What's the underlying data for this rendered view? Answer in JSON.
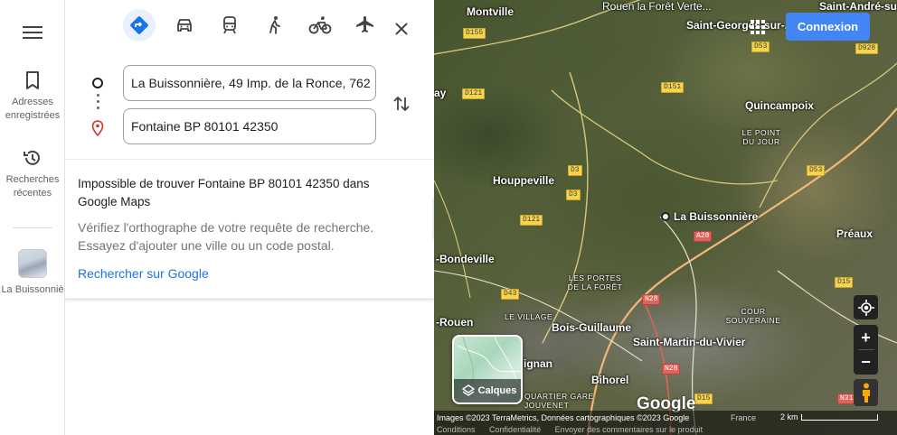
{
  "rail": {
    "saved_label": "Adresses enregistrées",
    "recent_label": "Recherches récentes",
    "place_label": "La Buissonniè"
  },
  "directions": {
    "origin_value": "La Buissonnière, 49 Imp. de la Ronce, 762",
    "destination_value": "Fontaine BP 80101 42350",
    "modes": [
      "best-route",
      "driving",
      "transit",
      "walking",
      "cycling",
      "flights"
    ],
    "active_mode": "best-route"
  },
  "message": {
    "title": "Impossible de trouver Fontaine BP 80101 42350 dans Google Maps",
    "body": "Vérifiez l'orthographe de votre requête de recherche. Essayez d'ajouter une ville ou un code postal.",
    "link": "Rechercher sur Google"
  },
  "map": {
    "connexion_label": "Connexion",
    "layers_label": "Calques",
    "google_logo": "Google",
    "attribution": "Images ©2023 TerraMetrics, Données cartographiques ©2023 Google",
    "country": "France",
    "scale": "2 km",
    "footer_links": [
      "Conditions",
      "Confidentialité",
      "Envoyer des commentaires sur le produit"
    ],
    "places": {
      "montville": "Montville",
      "rouen_foret": "Rouen la Forêt Verte...",
      "saint_georges": "Saint-Georges-sur-...",
      "saint_andre": "Saint-André-sur-",
      "quincampoix": "Quincampoix",
      "point_du_jour": "LE POINT DU JOUR",
      "houppeville": "Houppeville",
      "la_buissonniere": "La Buissonnière",
      "preaux": "Préaux",
      "bondeville": "-Bondeville",
      "portes_foret": "LES PORTES DE LA FORÊT",
      "le_village": "LE VILLAGE",
      "bois_guillaume": "Bois-Guillaume",
      "rouen": "-Rouen",
      "cour_souveraine": "COUR SOUVERAINE",
      "saint_martin": "Saint-Martin-du-Vivier",
      "agnan": "ignan",
      "bihorel": "Bihorel",
      "quartier_gare": "QUARTIER GARE JOUVENET",
      "ay": "ay"
    },
    "roads": [
      "D155",
      "D53",
      "D928",
      "D121",
      "D151",
      "D3",
      "D3",
      "D121",
      "A28",
      "D53",
      "D43",
      "N28",
      "D15",
      "N28",
      "D15",
      "N31"
    ]
  },
  "colors": {
    "accent": "#1a73e8",
    "connexion_bg": "#4285f4",
    "pin_red": "#d93025"
  }
}
